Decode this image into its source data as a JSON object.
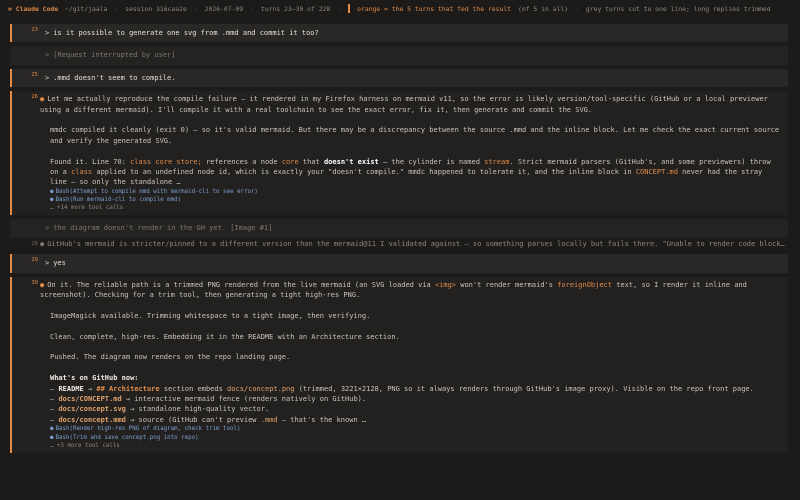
{
  "header": {
    "app_icon": "sparkle-icon",
    "app_name": "Claude Code",
    "path": "~/git/jaala",
    "session": "session 316caa2e",
    "date": "2026-07-09",
    "turns": "turns 23–30 of 228",
    "orange_note": "orange = the 5 turns that fed the result",
    "count_note": "(of 5 in all)",
    "grey_note": "grey turns cut to one line; long replies trimmed"
  },
  "turns": {
    "t23": {
      "num": "23",
      "text": "is it possible to generate one svg  from .mmd and commit it too?"
    },
    "t24": {
      "num": "",
      "text": "[Request interrupted by user]"
    },
    "t25": {
      "num": "25",
      "text": ".mmd doesn't seem to compile."
    },
    "t26": {
      "num": "26",
      "p1": "Let me actually reproduce the compile failure — it rendered in my Firefox harness on mermaid v11, so the error is likely version/tool-specific (GitHub or a local previewer using a different mermaid). I'll compile it with a real toolchain to see the exact error, fix it, then generate and commit the SVG.",
      "p2": "mmdc compiled it cleanly (exit 0) — so it's valid mermaid. But there may be a discrepancy between the source .mmd and the inline block. Let me check the exact current source and verify the generated SVG.",
      "p3_a": "Found it. Line 70: ",
      "p3_code1": "class core store;",
      "p3_b": " references a node ",
      "p3_code2": "core",
      "p3_c": " that ",
      "p3_bold": "doesn't exist",
      "p3_d": " — the cylinder is named ",
      "p3_code3": "stream",
      "p3_e": ". Strict mermaid parsers (GitHub's, and some previewers) throw on a ",
      "p3_code4": "class",
      "p3_f": " applied to an undefined node id, which is exactly your \"doesn't compile.\" mmdc happened to tolerate it, and the inline block in ",
      "p3_code5": "CONCEPT.md",
      "p3_g": " never had the stray line — so only the standalone …",
      "tool1": "Bash(Attempt to compile mmd with mermaid-cli to see error)",
      "tool2": "Bash(Run mermaid-cli to compile mmd)",
      "more": "… +14 more tool calls"
    },
    "t27": {
      "num": "",
      "text": "the diagram doesn't render in the GH yet. [Image #1]"
    },
    "t28": {
      "num": "28",
      "text": "GitHub's mermaid is stricter/pinned to a different version than the mermaid@11 I validated against — so something parses locally but fails there. \"Unable to render code block…"
    },
    "t29": {
      "num": "29",
      "text": "yes"
    },
    "t30": {
      "num": "30",
      "p1_a": "On it. The reliable path is a trimmed PNG rendered from the live mermaid (an SVG loaded via ",
      "p1_code1": "<img>",
      "p1_b": " won't render mermaid's ",
      "p1_code2": "foreignObject",
      "p1_c": " text, so I render it inline and screenshot). Checking for a trim tool, then generating a tight high-res PNG.",
      "p2": "ImageMagick available. Trimming whitespace to a tight image, then verifying.",
      "p3": "Clean, complete, high-res. Embedding it in the README with an Architecture section.",
      "p4": "Pushed. The diagram now renders on the repo landing page.",
      "p5_title": "What's on GitHub now:",
      "l1_a": "README",
      "l1_b": " → ",
      "l1_c": "## Architecture",
      "l1_d": " section embeds ",
      "l1_e": "docs/concept.png",
      "l1_f": " (trimmed, 3221×2128, PNG so it always renders through GitHub's image proxy). Visible on the repo front page.",
      "l2_a": "docs/CONCEPT.md",
      "l2_b": " → interactive mermaid fence (renders natively on GitHub).",
      "l3_a": "docs/concept.svg",
      "l3_b": " → standalone high-quality vector.",
      "l4_a": "docs/concept.mmd",
      "l4_b": " → source (GitHub can't preview ",
      "l4_c": ".mmd",
      "l4_d": " — that's the known …",
      "tool1": "Bash(Render high-res PNG of diagram, check trim tool)",
      "tool2": "Bash(Trim and save concept.png into repo)",
      "more": "… +3 more tool calls"
    }
  }
}
